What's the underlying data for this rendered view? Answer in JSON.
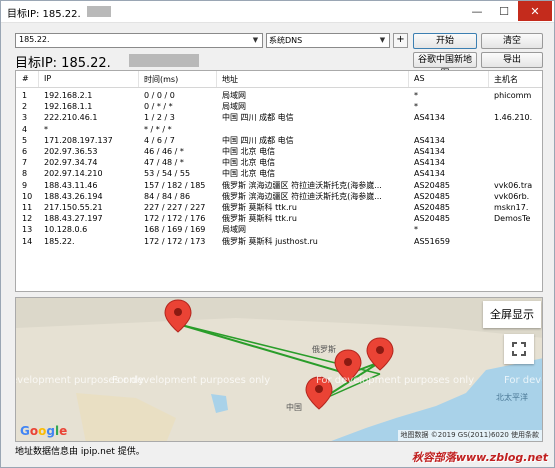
{
  "window": {
    "title": "目标IP: 185.22.",
    "close_label": "✕",
    "min_label": "—",
    "max_label": "☐"
  },
  "toolbar": {
    "target_value": "185.22.",
    "dns_value": "系统DNS",
    "plus_label": "+",
    "start_label": "开始",
    "clear_label": "清空",
    "google_cn_label": "谷歌中国新地图",
    "export_label": "导出"
  },
  "target_heading": "目标IP:  185.22.",
  "table": {
    "headers": [
      "#",
      "IP",
      "时间(ms)",
      "地址",
      "AS",
      "主机名"
    ],
    "rows": [
      [
        "1",
        "192.168.2.1",
        "0 / 0 / 0",
        "局域网",
        "*",
        "phicomm"
      ],
      [
        "2",
        "192.168.1.1",
        "0 / * / *",
        "局域网",
        "*",
        ""
      ],
      [
        "3",
        "222.210.46.1",
        "1 / 2 / 3",
        "中国 四川 成都 电信",
        "AS4134",
        "1.46.210."
      ],
      [
        "4",
        "*",
        "* / * / *",
        "",
        "",
        ""
      ],
      [
        "5",
        "171.208.197.137",
        "4 / 6 / 7",
        "中国 四川 成都 电信",
        "AS4134",
        ""
      ],
      [
        "6",
        "202.97.36.53",
        "46 / 46 / *",
        "中国 北京 电信",
        "AS4134",
        ""
      ],
      [
        "7",
        "202.97.34.74",
        "47 / 48 / *",
        "中国 北京 电信",
        "AS4134",
        ""
      ],
      [
        "8",
        "202.97.14.210",
        "53 / 54 / 55",
        "中国 北京 电信",
        "AS4134",
        ""
      ],
      [
        "9",
        "188.43.11.46",
        "157 / 182 / 185",
        "俄罗斯 滨海边疆区 符拉迪沃斯托克(海参崴...",
        "AS20485",
        "vvk06.tra"
      ],
      [
        "10",
        "188.43.26.194",
        "84 / 84 / 86",
        "俄罗斯 滨海边疆区 符拉迪沃斯托克(海参崴...",
        "AS20485",
        "vvk06rb."
      ],
      [
        "11",
        "217.150.55.21",
        "227 / 227 / 227",
        "俄罗斯 莫斯科 ttk.ru",
        "AS20485",
        "mskn17."
      ],
      [
        "12",
        "188.43.27.197",
        "172 / 172 / 176",
        "俄罗斯 莫斯科 ttk.ru",
        "AS20485",
        "DemosTe"
      ],
      [
        "13",
        "10.128.0.6",
        "168 / 169 / 169",
        "局域网",
        "*",
        ""
      ],
      [
        "14",
        "185.22.",
        "172 / 172 / 173",
        "俄罗斯 莫斯科 justhost.ru",
        "AS51659",
        ""
      ]
    ]
  },
  "map": {
    "watermark_text": "For development purposes only",
    "fullscreen_label": "全屏显示",
    "google_logo": "Google",
    "attribution": "地图数据 ©2019 GS(2011)6020  使用条款",
    "route_color": "#2a9d2a",
    "marker_color": "#ea4335",
    "labels": [
      "俄罗斯",
      "中国",
      "北太平洋"
    ]
  },
  "status_text": "地址数据信息由 ipip.net 提供。",
  "brand_watermark": "秋容部落www.zblog.net"
}
